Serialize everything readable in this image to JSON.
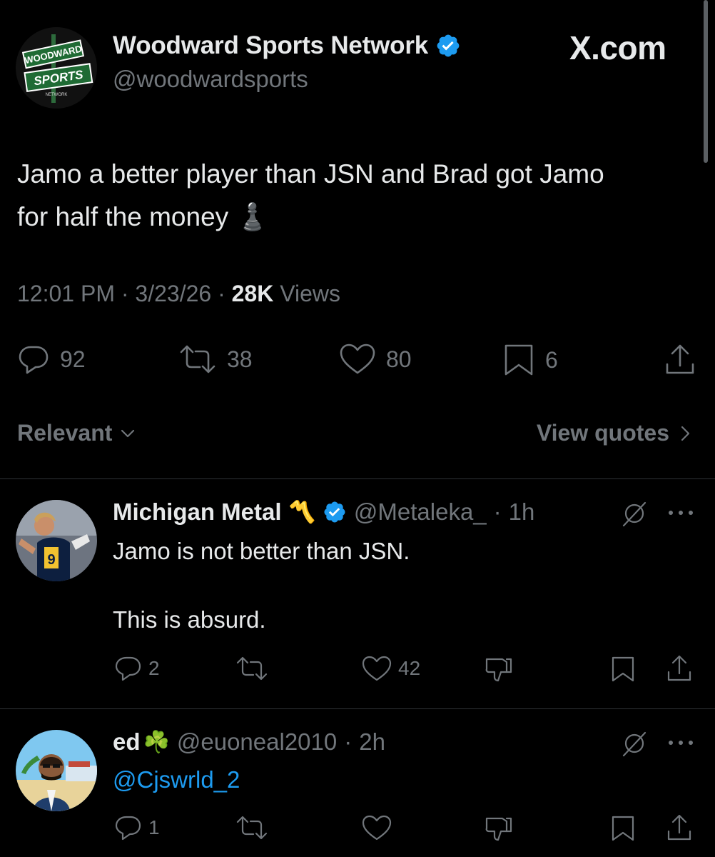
{
  "main_tweet": {
    "author_name": "Woodward Sports Network",
    "author_handle": "@woodwardsports",
    "avatar_logo_text_top": "WOODWARD",
    "avatar_logo_text_bottom": "SPORTS",
    "avatar_logo_text_small": "NETWORK",
    "watermark": "X.com",
    "text_line1": "Jamo a better player than JSN and Brad got Jamo",
    "text_line2": "for half the money ♟️",
    "time": "12:01 PM",
    "date": "3/23/26",
    "views_count": "28K",
    "views_label": "Views",
    "replies": "92",
    "reposts": "38",
    "likes": "80",
    "bookmarks": "6"
  },
  "sort_bar": {
    "sort_label": "Relevant",
    "quotes_label": "View quotes"
  },
  "replies": [
    {
      "name": "Michigan Metal",
      "badge_glyph": "〽️",
      "handle": "@Metaleka_",
      "time": "1h",
      "line1": "Jamo is not better than JSN.",
      "line2": "This is absurd.",
      "replies": "2",
      "reposts": "",
      "likes": "42"
    },
    {
      "name": "ed",
      "badge_glyph": "☘️",
      "handle": "@euoneal2010",
      "time": "2h",
      "mention": "@Cjswrld_2",
      "replies": "1",
      "reposts": "",
      "likes": ""
    }
  ],
  "separator": "·",
  "colors": {
    "background": "#000000",
    "text": "#e7e9ea",
    "muted": "#71767b",
    "verified": "#1d9bf0",
    "divider": "#2f3336"
  }
}
